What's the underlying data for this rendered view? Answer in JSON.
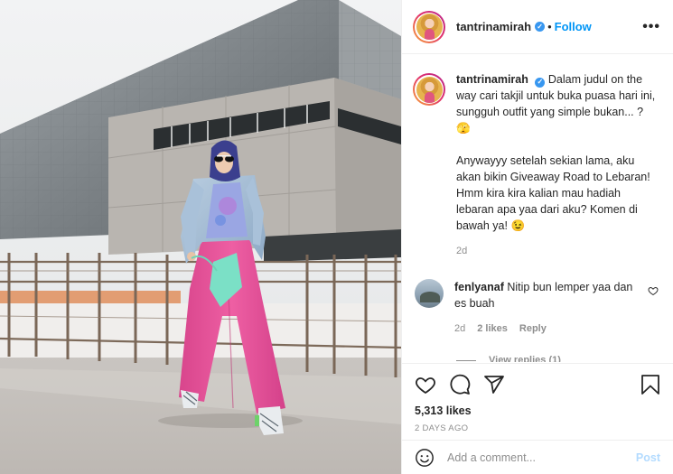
{
  "post": {
    "username": "tantrinamirah",
    "follow_label": "Follow",
    "separator": "•",
    "more_label": "•••",
    "verified_mark": "✓",
    "caption": {
      "username": "tantrinamirah",
      "line1": "Dalam judul on the way cari takjil untuk buka puasa hari ini, sungguh outfit yang simple bukan... ? 🫣",
      "line2": "Anywayyy setelah sekian lama, aku akan bikin Giveaway Road to Lebaran! Hmm kira kira kalian mau hadiah lebaran apa yaa dari aku? Komen di bawah ya! 😉",
      "time": "2d"
    },
    "comment": {
      "username": "fenlyanaf",
      "text": "Nitip bun lemper yaa dan es buah",
      "time": "2d",
      "likes": "2 likes",
      "reply_label": "Reply",
      "view_replies": "View replies (1)"
    },
    "likes": "5,313 likes",
    "posted_ago": "2 DAYS AGO",
    "add_comment_placeholder": "Add a comment...",
    "post_label": "Post",
    "icons": [
      "heart-icon",
      "comment-icon",
      "share-icon",
      "bookmark-icon",
      "emoji-icon",
      "more-icon",
      "verified-icon"
    ],
    "colors": {
      "accent": "#0095f6",
      "verified": "#3897f0",
      "post_disabled": "#b3dbff",
      "muted": "#8e8e8e",
      "text": "#262626",
      "pants": "#e8529a"
    }
  }
}
